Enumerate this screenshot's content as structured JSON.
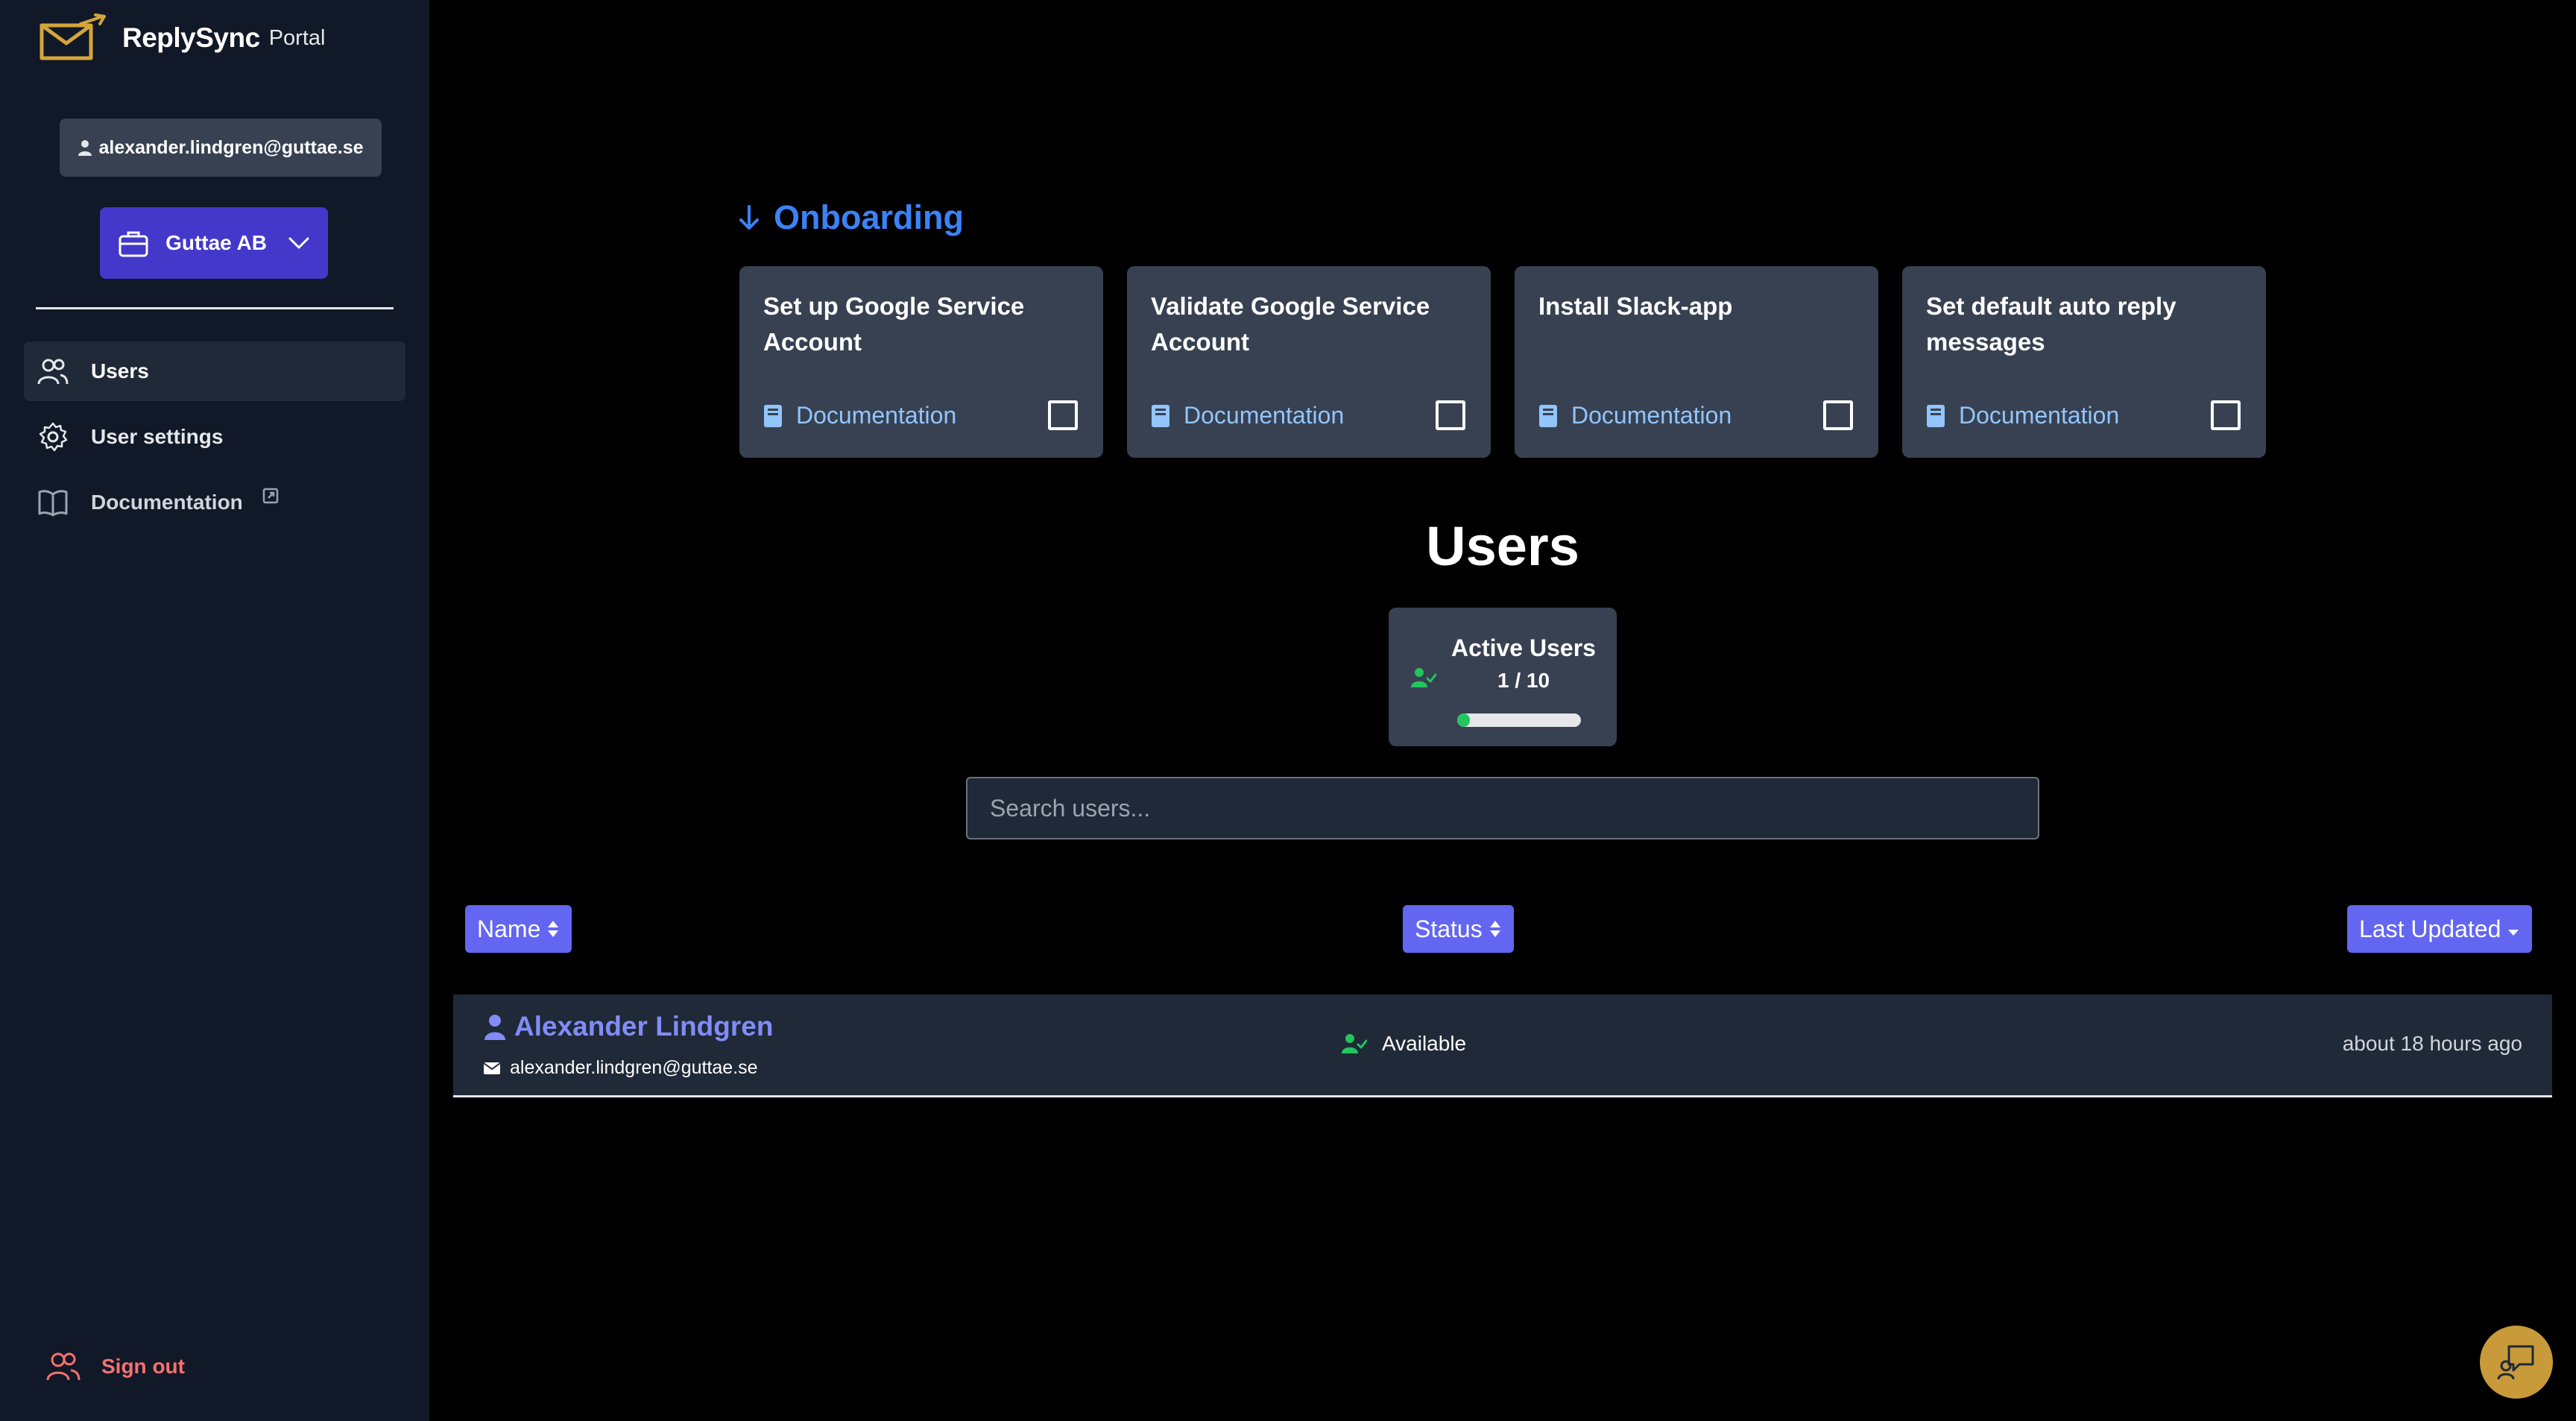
{
  "brand": {
    "name": "ReplySync",
    "suffix": "Portal"
  },
  "account": {
    "email": "alexander.lindgren@guttae.se"
  },
  "org": {
    "name": "Guttae AB"
  },
  "nav": {
    "items": [
      {
        "label": "Users",
        "icon": "users-icon",
        "active": true
      },
      {
        "label": "User settings",
        "icon": "gear-icon",
        "active": false
      },
      {
        "label": "Documentation",
        "icon": "book-open-icon",
        "active": false,
        "external": true
      }
    ]
  },
  "signout": {
    "label": "Sign out"
  },
  "onboarding": {
    "title": "Onboarding",
    "cards": [
      {
        "title": "Set up Google Service Account",
        "doc_label": "Documentation",
        "checked": false
      },
      {
        "title": "Validate Google Service Account",
        "doc_label": "Documentation",
        "checked": false
      },
      {
        "title": "Install Slack-app",
        "doc_label": "Documentation",
        "checked": false
      },
      {
        "title": "Set default auto reply messages",
        "doc_label": "Documentation",
        "checked": false
      }
    ]
  },
  "users_section": {
    "heading": "Users",
    "stat": {
      "label": "Active Users",
      "value": "1 / 10",
      "progress_fraction": 0.1
    },
    "search": {
      "placeholder": "Search users...",
      "value": ""
    },
    "columns": {
      "name": "Name",
      "status": "Status",
      "last_updated": "Last Updated"
    },
    "rows": [
      {
        "name": "Alexander Lindgren",
        "email": "alexander.lindgren@guttae.se",
        "status": "Available",
        "updated": "about 18 hours ago"
      }
    ]
  },
  "colors": {
    "accent": "#6366f1",
    "org_button": "#4338ca",
    "onboarding_title": "#3b82f6",
    "status_available": "#22c55e",
    "signout": "#f87171",
    "chat_fab": "#c89a3a"
  }
}
